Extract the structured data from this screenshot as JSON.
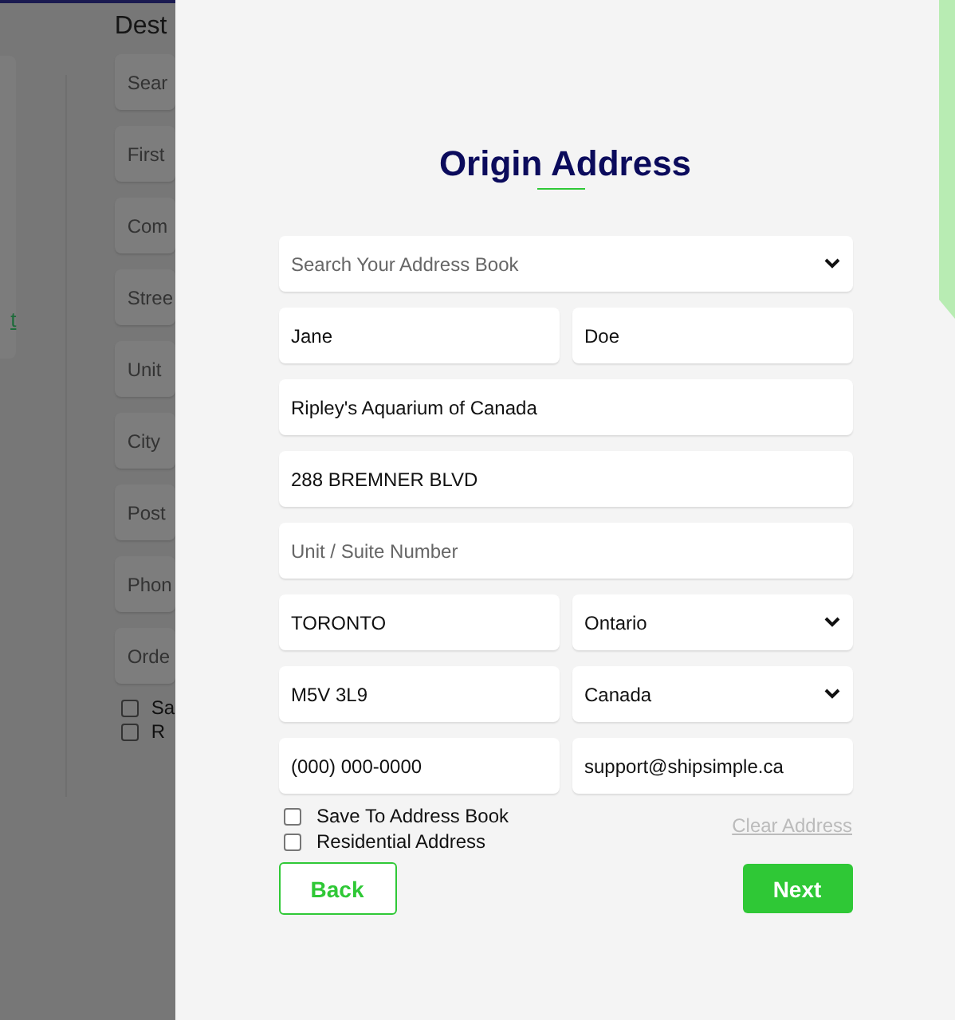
{
  "background": {
    "link": "t",
    "heading": "Dest",
    "fields": [
      "Sear",
      "First",
      "Com",
      "Stree",
      "Unit",
      "City",
      "Post",
      "Phon",
      "Orde"
    ],
    "checkboxes": [
      {
        "label": "Sa",
        "checked": false
      },
      {
        "label": "R",
        "checked": false
      }
    ]
  },
  "panel": {
    "title": "Origin Address",
    "rows": [
      [
        {
          "kind": "select",
          "placeholder": "Search Your Address Book"
        }
      ],
      [
        {
          "kind": "input",
          "value": "Jane"
        },
        {
          "kind": "input",
          "value": "Doe"
        }
      ],
      [
        {
          "kind": "input",
          "value": "Ripley's Aquarium of Canada"
        }
      ],
      [
        {
          "kind": "input",
          "value": "288 BREMNER BLVD"
        }
      ],
      [
        {
          "kind": "input",
          "placeholder": "Unit / Suite Number"
        }
      ],
      [
        {
          "kind": "input",
          "value": "TORONTO"
        },
        {
          "kind": "select",
          "value": "Ontario"
        }
      ],
      [
        {
          "kind": "input",
          "value": "M5V 3L9"
        },
        {
          "kind": "select",
          "value": "Canada"
        }
      ],
      [
        {
          "kind": "input",
          "value": "(000) 000-0000"
        },
        {
          "kind": "input",
          "value": "support@shipsimple.ca"
        }
      ]
    ],
    "checkboxes": [
      {
        "label": "Save To Address Book",
        "checked": false
      },
      {
        "label": "Residential Address",
        "checked": false
      }
    ],
    "clear_link": "Clear Address",
    "buttons": {
      "back": "Back",
      "next": "Next"
    }
  }
}
